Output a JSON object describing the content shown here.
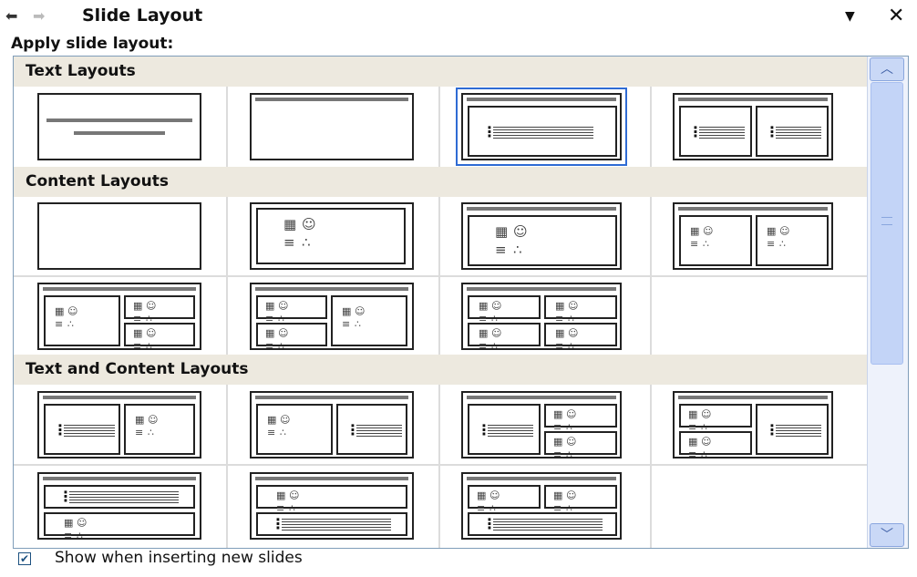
{
  "title_bar": {
    "title": "Slide Layout",
    "back_glyph": "⬅",
    "forward_glyph": "➡",
    "dropdown_glyph": "▼",
    "close_glyph": "✕"
  },
  "apply_label": "Apply slide layout:",
  "sections": [
    {
      "label": "Text Layouts"
    },
    {
      "label": "Content Layouts"
    },
    {
      "label": "Text and Content Layouts"
    }
  ],
  "layouts": [
    {
      "name": "title-slide"
    },
    {
      "name": "title-only"
    },
    {
      "name": "title-and-text",
      "selected": true
    },
    {
      "name": "title-and-2-column-text"
    },
    {
      "name": "blank"
    },
    {
      "name": "content"
    },
    {
      "name": "title-and-content"
    },
    {
      "name": "title-and-2-content"
    },
    {
      "name": "title-content-and-2-content"
    },
    {
      "name": "title-2-content-and-content"
    },
    {
      "name": "title-and-4-content"
    },
    {
      "name": "title-text-and-content"
    },
    {
      "name": "title-content-and-text"
    },
    {
      "name": "title-text-and-2-content"
    },
    {
      "name": "title-2-content-and-text"
    },
    {
      "name": "title-text-over-content"
    },
    {
      "name": "title-content-over-text"
    },
    {
      "name": "title-2-content-over-text"
    }
  ],
  "scrollbar": {
    "up_glyph": "︿",
    "down_glyph": "﹀"
  },
  "footer": {
    "checkbox_label": "Show when inserting new slides",
    "checked": true,
    "check_glyph": "✔"
  },
  "colors": {
    "selection": "#2f6bd4",
    "section_bg": "#ede9df"
  }
}
